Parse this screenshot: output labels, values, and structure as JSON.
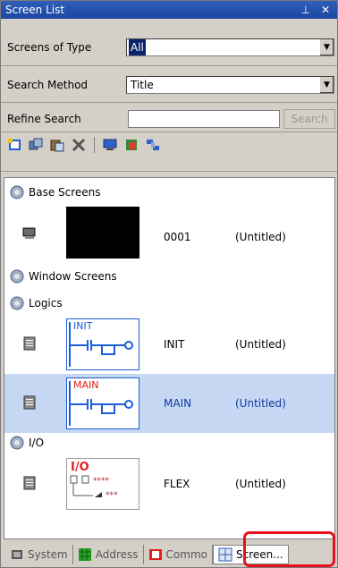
{
  "panel": {
    "title": "Screen List",
    "title_icons": [
      "pin-icon",
      "close-icon"
    ],
    "pin_glyph": "⊥",
    "close_glyph": "✕"
  },
  "filters": {
    "type_label": "Screens of Type",
    "type_value": "All",
    "method_label": "Search Method",
    "method_value": "Title",
    "refine_label": "Refine Search",
    "refine_placeholder": "",
    "search_button": "Search"
  },
  "toolbar": {
    "icons": [
      "new-screen-icon",
      "copy-screen-icon",
      "paste-screen-icon",
      "delete-icon",
      "display-icon",
      "properties-icon",
      "arrange-icon"
    ]
  },
  "list": {
    "groups": [
      {
        "label": "Base Screens"
      },
      {
        "label": "Window Screens"
      },
      {
        "label": "Logics"
      },
      {
        "label": "I/O"
      }
    ],
    "items": [
      {
        "number": "0001",
        "title": "(Untitled)",
        "thumb": "black"
      },
      {
        "number": "INIT",
        "title": "(Untitled)",
        "thumb": "init",
        "thumb_text": "INIT",
        "thumb_color": "#1b5ed8"
      },
      {
        "number": "MAIN",
        "title": "(Untitled)",
        "thumb": "main",
        "thumb_text": "MAIN",
        "thumb_color": "#e0201c"
      },
      {
        "number": "FLEX",
        "title": "(Untitled)",
        "thumb": "io",
        "thumb_text": "I/O",
        "thumb_stars": "****",
        "thumb_stars2": "***"
      }
    ]
  },
  "tabs": [
    {
      "label": "System",
      "icon": "system-icon"
    },
    {
      "label": "Address",
      "icon": "address-icon"
    },
    {
      "label": "Commo",
      "icon": "common-icon"
    },
    {
      "label": "Screen...",
      "icon": "screen-list-icon"
    }
  ],
  "colors": {
    "titlebar": "#1c46a3",
    "selection": "#c6d7f3",
    "highlight": "#e8101e"
  }
}
